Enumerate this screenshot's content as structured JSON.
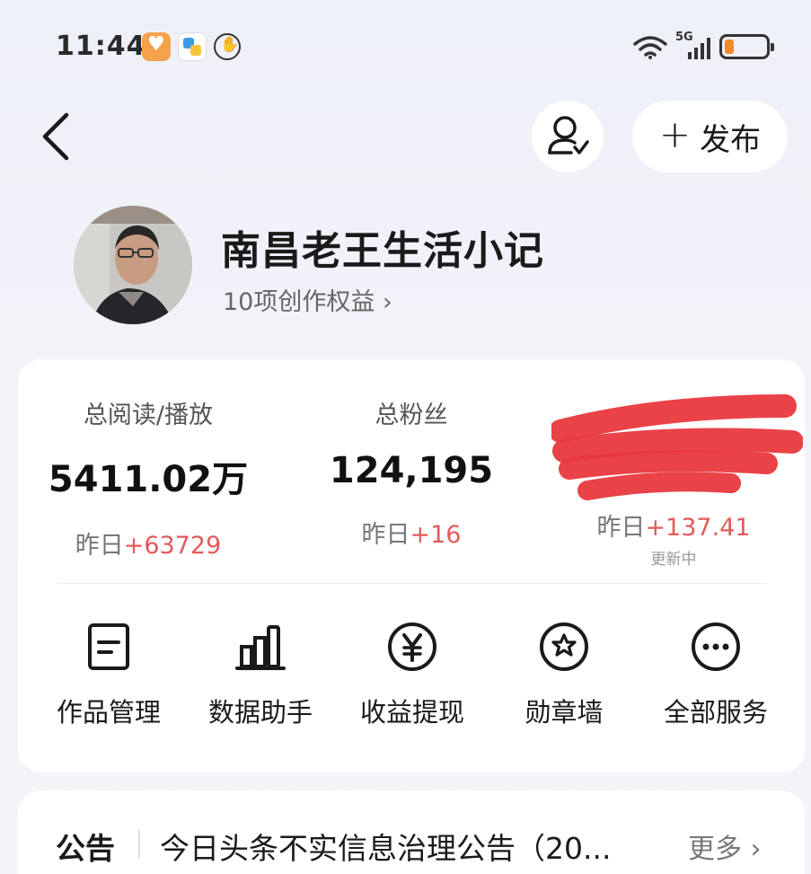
{
  "status_bar": {
    "time": "11:44",
    "network": "5G",
    "battery_level": 0.22,
    "battery_color": "#f08a2e"
  },
  "header": {
    "back_icon": "chevron-left-icon",
    "profile_switch_icon": "user-check-icon",
    "publish_label": "发布"
  },
  "profile": {
    "name": "南昌老王生活小记",
    "rights_label": "10项创作权益"
  },
  "stats": [
    {
      "label": "总阅读/播放",
      "value": "5411.02万",
      "delta_prefix": "昨日",
      "delta": "+63729"
    },
    {
      "label": "总粉丝",
      "value": "124,195",
      "delta_prefix": "昨日",
      "delta": "+16"
    },
    {
      "label": "",
      "value": "",
      "delta_prefix": "昨日",
      "delta": "+137.41",
      "note": "更新中"
    }
  ],
  "services": [
    {
      "label": "作品管理",
      "icon": "document-icon"
    },
    {
      "label": "数据助手",
      "icon": "bar-chart-icon"
    },
    {
      "label": "收益提现",
      "icon": "yen-icon"
    },
    {
      "label": "勋章墙",
      "icon": "medal-icon"
    },
    {
      "label": "全部服务",
      "icon": "more-icon"
    }
  ],
  "notice": {
    "tag": "公告",
    "text": "今日头条不实信息治理公告（20...",
    "more_label": "更多"
  },
  "colors": {
    "accent_red": "#e35a5a",
    "redaction": "#e8383d"
  }
}
